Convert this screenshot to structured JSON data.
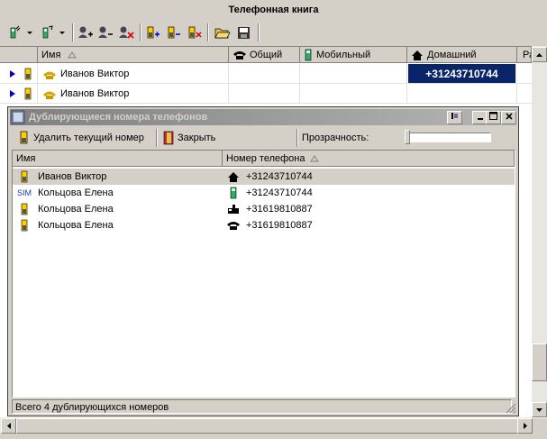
{
  "window": {
    "title": "Телефонная книга"
  },
  "toolbar": [
    {
      "name": "add-contact-button",
      "icon": "phone-add-icon"
    },
    {
      "name": "edit-contact-button",
      "icon": "phone-edit-icon"
    },
    {
      "name": "add-person-button",
      "icon": "person-add-icon"
    },
    {
      "name": "remove-person-button",
      "icon": "person-remove-icon"
    },
    {
      "name": "delete-person-button",
      "icon": "person-delete-icon"
    },
    {
      "name": "add-number-button",
      "icon": "battery-add-icon"
    },
    {
      "name": "remove-number-button",
      "icon": "battery-remove-icon"
    },
    {
      "name": "delete-number-button",
      "icon": "battery-delete-icon"
    },
    {
      "name": "open-button",
      "icon": "folder-open-icon"
    },
    {
      "name": "save-button",
      "icon": "floppy-icon"
    }
  ],
  "grid": {
    "columns": [
      "Имя",
      "Общий",
      "Мобильный",
      "Домашний",
      "Ра"
    ],
    "rows": [
      {
        "name": "Иванов Виктор",
        "home": "+31243710744"
      },
      {
        "name": "Иванов Виктор",
        "home": ""
      }
    ]
  },
  "dialog": {
    "title": "Дублирующиеся номера телефонов",
    "delete_label": "Удалить текущий номер",
    "close_label": "Закрыть",
    "transparency_label": "Прозрачность:",
    "columns": [
      "Имя",
      "Номер телефона"
    ],
    "rows": [
      {
        "icon": "mobile-phone-icon",
        "name": "Иванов Виктор",
        "type_icon": "home-icon",
        "number": "+31243710744"
      },
      {
        "icon": "sim-icon",
        "name": "Кольцова Елена",
        "type_icon": "mobile-icon",
        "number": "+31243710744"
      },
      {
        "icon": "mobile-phone-icon",
        "name": "Кольцова Елена",
        "type_icon": "fax-icon",
        "number": "+31619810887"
      },
      {
        "icon": "mobile-phone-icon",
        "name": "Кольцова Елена",
        "type_icon": "phone-icon",
        "number": "+31619810887"
      }
    ],
    "sim_label": "SIM",
    "status": "Всего 4 дублирующихся номеров"
  },
  "colors": {
    "selected_cell": "#0a246a",
    "arrow": "#0000c0",
    "title_active": "#808080"
  }
}
